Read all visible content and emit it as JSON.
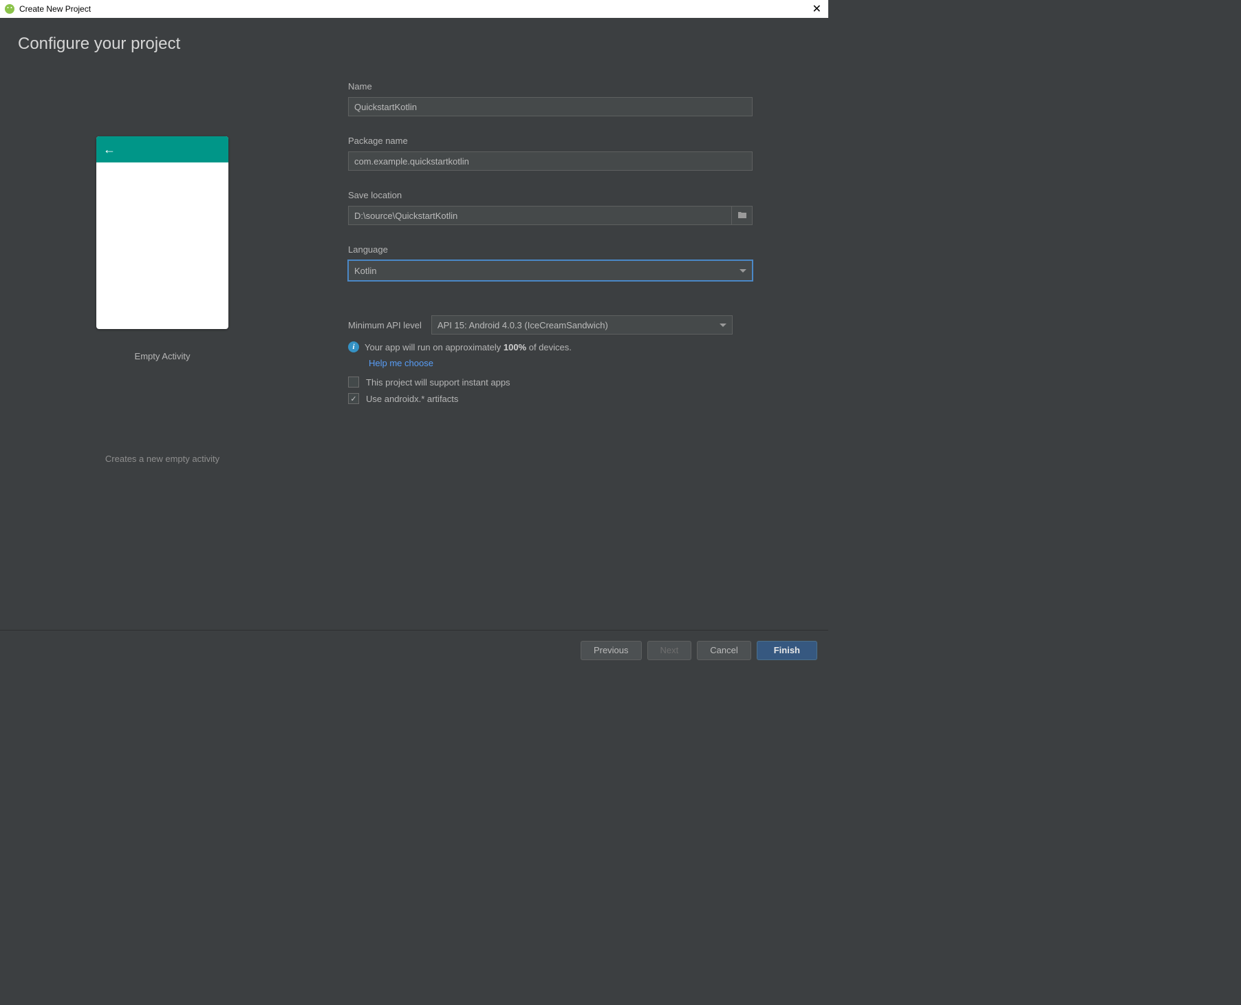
{
  "titlebar": {
    "title": "Create New Project"
  },
  "page": {
    "heading": "Configure your project"
  },
  "preview": {
    "label": "Empty Activity",
    "description": "Creates a new empty activity"
  },
  "form": {
    "name_label": "Name",
    "name_value": "QuickstartKotlin",
    "package_label": "Package name",
    "package_value": "com.example.quickstartkotlin",
    "location_label": "Save location",
    "location_value": "D:\\source\\QuickstartKotlin",
    "language_label": "Language",
    "language_value": "Kotlin",
    "api_label": "Minimum API level",
    "api_value": "API 15: Android 4.0.3 (IceCreamSandwich)",
    "info_text_pre": "Your app will run on approximately ",
    "info_text_bold": "100%",
    "info_text_post": " of devices.",
    "help_link": "Help me choose",
    "instant_apps_label": "This project will support instant apps",
    "androidx_label": "Use androidx.* artifacts"
  },
  "footer": {
    "previous": "Previous",
    "next": "Next",
    "cancel": "Cancel",
    "finish": "Finish"
  }
}
